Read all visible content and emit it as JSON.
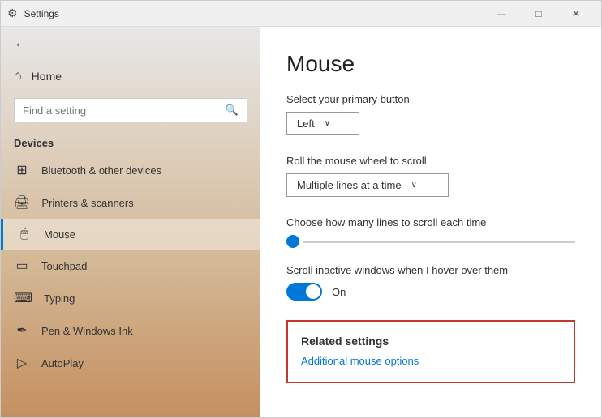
{
  "window": {
    "title": "Settings",
    "controls": {
      "minimize": "—",
      "maximize": "□",
      "close": "✕"
    }
  },
  "sidebar": {
    "back_icon": "←",
    "home_label": "Home",
    "home_icon": "⌂",
    "search_placeholder": "Find a setting",
    "search_icon": "🔍",
    "devices_label": "Devices",
    "nav_items": [
      {
        "id": "bluetooth",
        "label": "Bluetooth & other devices",
        "icon": "⊞"
      },
      {
        "id": "printers",
        "label": "Printers & scanners",
        "icon": "🖨"
      },
      {
        "id": "mouse",
        "label": "Mouse",
        "icon": "🖱"
      },
      {
        "id": "touchpad",
        "label": "Touchpad",
        "icon": "▭"
      },
      {
        "id": "typing",
        "label": "Typing",
        "icon": "⌨"
      },
      {
        "id": "pen",
        "label": "Pen & Windows Ink",
        "icon": "✒"
      },
      {
        "id": "autoplay",
        "label": "AutoPlay",
        "icon": "▷"
      }
    ]
  },
  "main": {
    "title": "Mouse",
    "primary_button_label": "Select your primary button",
    "primary_button_value": "Left",
    "primary_button_arrow": "∨",
    "scroll_label": "Roll the mouse wheel to scroll",
    "scroll_value": "Multiple lines at a time",
    "scroll_arrow": "∨",
    "lines_label": "Choose how many lines to scroll each time",
    "inactive_label": "Scroll inactive windows when I hover over them",
    "toggle_state": "On",
    "related_title": "Related settings",
    "related_link": "Additional mouse options"
  }
}
